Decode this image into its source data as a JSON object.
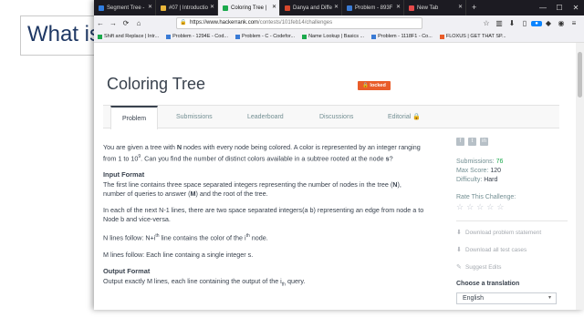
{
  "slide": {
    "title": "What is"
  },
  "browser": {
    "tabs": [
      {
        "label": "Segment Tree - ",
        "color": "#2f7de1"
      },
      {
        "label": "#07 | Introductio",
        "color": "#e8b53a"
      },
      {
        "label": "Coloring Tree | ",
        "color": "#1ba94c",
        "active": true
      },
      {
        "label": "Danya and Diffe",
        "color": "#d7472c"
      },
      {
        "label": "Problem - 893F ",
        "color": "#3a7bd5"
      },
      {
        "label": "New Tab",
        "color": "#e64a4a"
      }
    ],
    "new_tab_label": "+",
    "window_controls": {
      "minimize": "—",
      "maximize": "☐",
      "close": "✕"
    },
    "url": {
      "main": "https://www.hackerrank.com",
      "rest": "/contests/101feb14/challenges"
    },
    "bookmarks": [
      "Shift and Replace | Intr...",
      "Problem - 1294E - Cod...",
      "Problem - C - Codefor...",
      "Name Lookup | Basics ...",
      "Problem - 1118F1 - Co...",
      "FLOXUS | GET THAT SP..."
    ]
  },
  "problem": {
    "title": "Coloring Tree",
    "locked_label": "🔒 locked",
    "tabs": [
      "Problem",
      "Submissions",
      "Leaderboard",
      "Discussions",
      "Editorial 🔒"
    ],
    "intro_1": "You are given a tree with ",
    "intro_N": "N",
    "intro_2": " nodes with every node being colored. A color is represented by an integer ranging from 1 to 10",
    "intro_sup": "9",
    "intro_3": ". Can you find the number of distinct colors available in a subtree rooted at the node ",
    "intro_s": "s",
    "intro_4": "?",
    "input_heading": "Input Format",
    "input_1a": "The first line contains three space separated integers representing the number of nodes in the tree (",
    "input_1N": "N",
    "input_1b": "), number of queries to answer (",
    "input_1M": "M",
    "input_1c": ") and the root of the tree.",
    "input_2": "In each of the next N-1 lines, there are two space separated integers(a b) representing an edge from node a to Node b and vice-versa.",
    "input_3a": "N lines follow: N+i",
    "input_3sup1": "th",
    "input_3b": " line contains the color of the i",
    "input_3sup2": "th",
    "input_3c": " node.",
    "input_4": "M lines follow: Each line containg a single integer s.",
    "output_heading": "Output Format",
    "output_1a": "Output exactly M lines, each line containing the output of the i",
    "output_1sub": "th",
    "output_1b": " query."
  },
  "sidebar": {
    "social": [
      "f",
      "t",
      "in"
    ],
    "submissions_label": "Submissions: ",
    "submissions_value": "76",
    "max_score_label": "Max Score: ",
    "max_score_value": "120",
    "difficulty_label": "Difficulty: ",
    "difficulty_value": "Hard",
    "rate_label": "Rate This Challenge:",
    "stars": [
      "☆",
      "☆",
      "☆",
      "☆",
      "☆"
    ],
    "download_statement": "Download problem statement",
    "download_tests": "Download all test cases",
    "suggest_edits": "Suggest Edits",
    "translate_label": "Choose a translation",
    "translate_value": "English"
  }
}
